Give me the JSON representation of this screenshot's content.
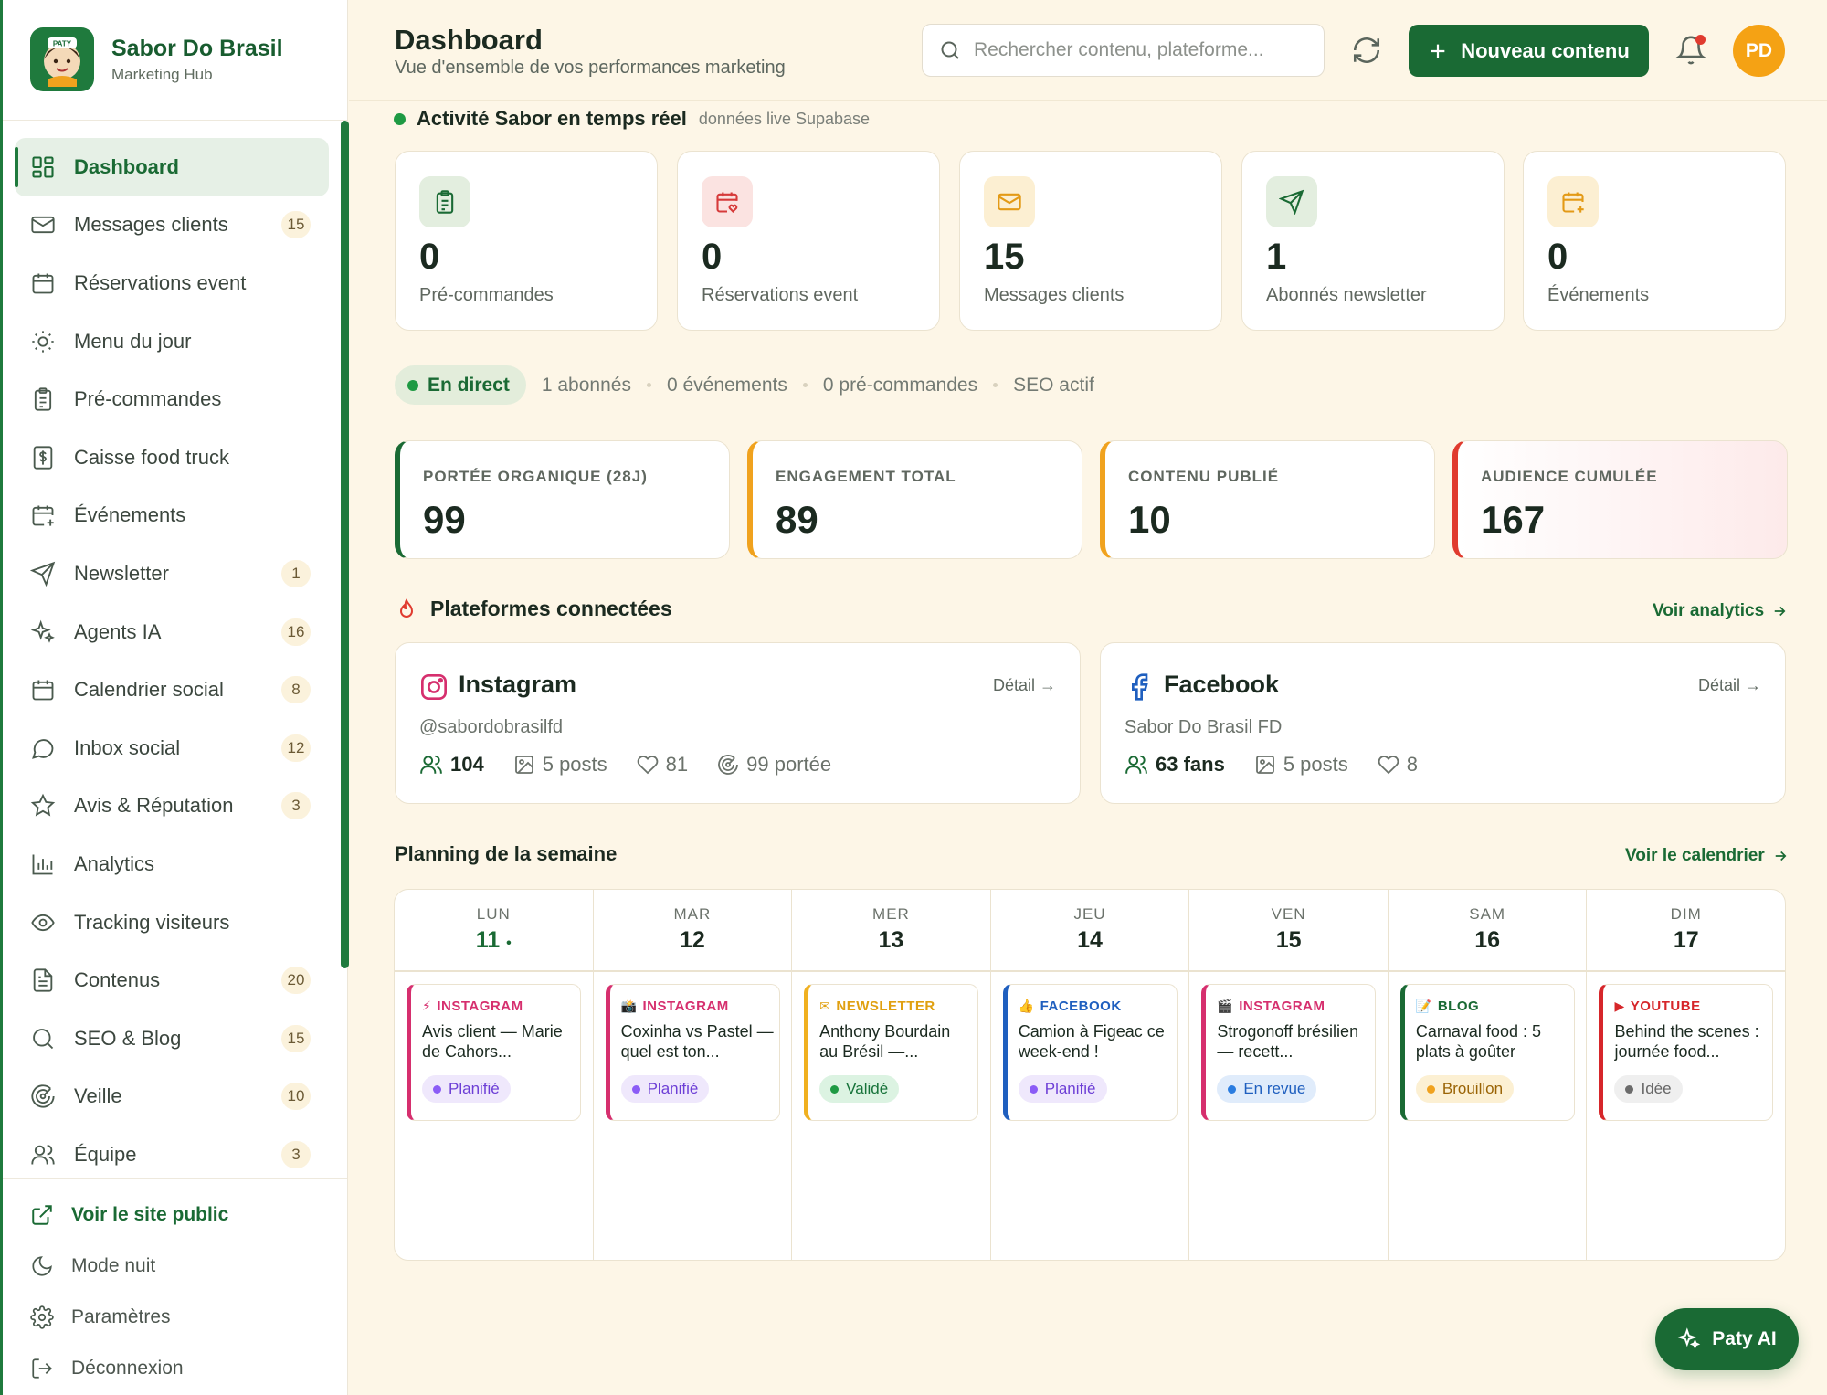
{
  "brand": {
    "title": "Sabor Do Brasil",
    "subtitle": "Marketing Hub",
    "logo_text": "PATY"
  },
  "nav": {
    "items": [
      {
        "label": "Dashboard",
        "icon": "grid-icon",
        "badge": "",
        "active": true
      },
      {
        "label": "Messages clients",
        "icon": "mail-icon",
        "badge": "15"
      },
      {
        "label": "Réservations event",
        "icon": "calendar-icon",
        "badge": ""
      },
      {
        "label": "Menu du jour",
        "icon": "sun-icon",
        "badge": ""
      },
      {
        "label": "Pré-commandes",
        "icon": "clipboard-icon",
        "badge": ""
      },
      {
        "label": "Caisse food truck",
        "icon": "cash-register-icon",
        "badge": ""
      },
      {
        "label": "Événements",
        "icon": "calendar-plus-icon",
        "badge": ""
      },
      {
        "label": "Newsletter",
        "icon": "send-icon",
        "badge": "1"
      },
      {
        "label": "Agents IA",
        "icon": "sparkles-icon",
        "badge": "16"
      },
      {
        "label": "Calendrier social",
        "icon": "calendar-icon",
        "badge": "8"
      },
      {
        "label": "Inbox social",
        "icon": "chat-bubble-icon",
        "badge": "12"
      },
      {
        "label": "Avis & Réputation",
        "icon": "star-icon",
        "badge": "3"
      },
      {
        "label": "Analytics",
        "icon": "bar-chart-icon",
        "badge": ""
      },
      {
        "label": "Tracking visiteurs",
        "icon": "eye-icon",
        "badge": ""
      },
      {
        "label": "Contenus",
        "icon": "document-icon",
        "badge": "20"
      },
      {
        "label": "SEO & Blog",
        "icon": "search-icon",
        "badge": "15"
      },
      {
        "label": "Veille",
        "icon": "radar-icon",
        "badge": "10"
      },
      {
        "label": "Équipe",
        "icon": "users-icon",
        "badge": "3"
      }
    ]
  },
  "footer": {
    "public_site": "Voir le site public",
    "dark_mode": "Mode nuit",
    "settings": "Paramètres",
    "logout": "Déconnexion"
  },
  "header": {
    "title": "Dashboard",
    "subtitle": "Vue d'ensemble de vos performances marketing",
    "search_placeholder": "Rechercher contenu, plateforme...",
    "new_button": "Nouveau contenu",
    "avatar": "PD"
  },
  "live": {
    "title": "Activité Sabor en temps réel",
    "subtitle": "données live Supabase"
  },
  "stats": [
    {
      "value": "0",
      "label": "Pré-commandes",
      "icon": "clipboard-icon",
      "color": "#1a6a34",
      "bg": "#e3eedf"
    },
    {
      "value": "0",
      "label": "Réservations event",
      "icon": "calendar-heart-icon",
      "color": "#d63a3a",
      "bg": "#fbe3e1"
    },
    {
      "value": "15",
      "label": "Messages clients",
      "icon": "mail-icon",
      "color": "#e39a16",
      "bg": "#fcefd2"
    },
    {
      "value": "1",
      "label": "Abonnés newsletter",
      "icon": "send-icon",
      "color": "#1a6a34",
      "bg": "#e3eedf"
    },
    {
      "value": "0",
      "label": "Événements",
      "icon": "calendar-plus-icon",
      "color": "#e39a16",
      "bg": "#fcefd2"
    }
  ],
  "pills": {
    "live": "En direct",
    "items": [
      "1 abonnés",
      "0 événements",
      "0 pré-commandes",
      "SEO actif"
    ]
  },
  "kpis": [
    {
      "label": "PORTÉE ORGANIQUE (28J)",
      "value": "99",
      "color": "#1a6a34"
    },
    {
      "label": "ENGAGEMENT TOTAL",
      "value": "89",
      "color": "#f0a21e"
    },
    {
      "label": "CONTENU PUBLIÉ",
      "value": "10",
      "color": "#f0a21e"
    },
    {
      "label": "AUDIENCE CUMULÉE",
      "value": "167",
      "color": "#e03b2f"
    }
  ],
  "platforms": {
    "title": "Plateformes connectées",
    "link": "Voir analytics",
    "items": [
      {
        "name": "Instagram",
        "detail": "Détail →",
        "handle": "@sabordobrasilfd",
        "followers": "104",
        "posts": "5 posts",
        "likes": "81",
        "reach": "99 portée"
      },
      {
        "name": "Facebook",
        "detail": "Détail →",
        "handle": "Sabor Do Brasil FD",
        "followers": "63 fans",
        "posts": "5 posts",
        "likes": "8"
      }
    ]
  },
  "planning": {
    "title": "Planning de la semaine",
    "link": "Voir le calendrier",
    "days": [
      {
        "day": "LUN",
        "num": "11",
        "today_mark": "•",
        "event": {
          "platform": "INSTAGRAM",
          "emoji": "⚡",
          "color": "#d62f6e",
          "title": "Avis client — Marie de Cahors...",
          "status": "Planifié",
          "status_color": "#8b5cf6",
          "status_bg": "#efe8fc"
        }
      },
      {
        "day": "MAR",
        "num": "12",
        "event": {
          "platform": "INSTAGRAM",
          "emoji": "📸",
          "color": "#d62f6e",
          "title": "Coxinha vs Pastel — quel est ton...",
          "status": "Planifié",
          "status_color": "#8b5cf6",
          "status_bg": "#efe8fc"
        }
      },
      {
        "day": "MER",
        "num": "13",
        "event": {
          "platform": "NEWSLETTER",
          "emoji": "✉",
          "color": "#f0b020",
          "title": "Anthony Bourdain au Brésil —...",
          "status": "Validé",
          "status_color": "#1e9a43",
          "status_bg": "#dcf3e2"
        }
      },
      {
        "day": "JEU",
        "num": "14",
        "event": {
          "platform": "FACEBOOK",
          "emoji": "👍",
          "color": "#1f5fbf",
          "title": "Camion à Figeac ce week-end !",
          "status": "Planifié",
          "status_color": "#8b5cf6",
          "status_bg": "#efe8fc"
        }
      },
      {
        "day": "VEN",
        "num": "15",
        "event": {
          "platform": "INSTAGRAM",
          "emoji": "🎬",
          "color": "#d62f6e",
          "title": "Strogonoff brésilien — recett...",
          "status": "En revue",
          "status_color": "#2b7de0",
          "status_bg": "#e0ecfb"
        }
      },
      {
        "day": "SAM",
        "num": "16",
        "event": {
          "platform": "BLOG",
          "emoji": "📝",
          "color": "#1a6a34",
          "title": "Carnaval food : 5 plats à goûter",
          "status": "Brouillon",
          "status_color": "#f0a21e",
          "status_bg": "#fcf0d3"
        }
      },
      {
        "day": "DIM",
        "num": "17",
        "event": {
          "platform": "YOUTUBE",
          "emoji": "▶",
          "color": "#d6262a",
          "title": "Behind the scenes : journée food...",
          "status": "Idée",
          "status_color": "#6b6b6b",
          "status_bg": "#efefef"
        }
      }
    ]
  },
  "assistant": {
    "label": "Paty AI"
  }
}
